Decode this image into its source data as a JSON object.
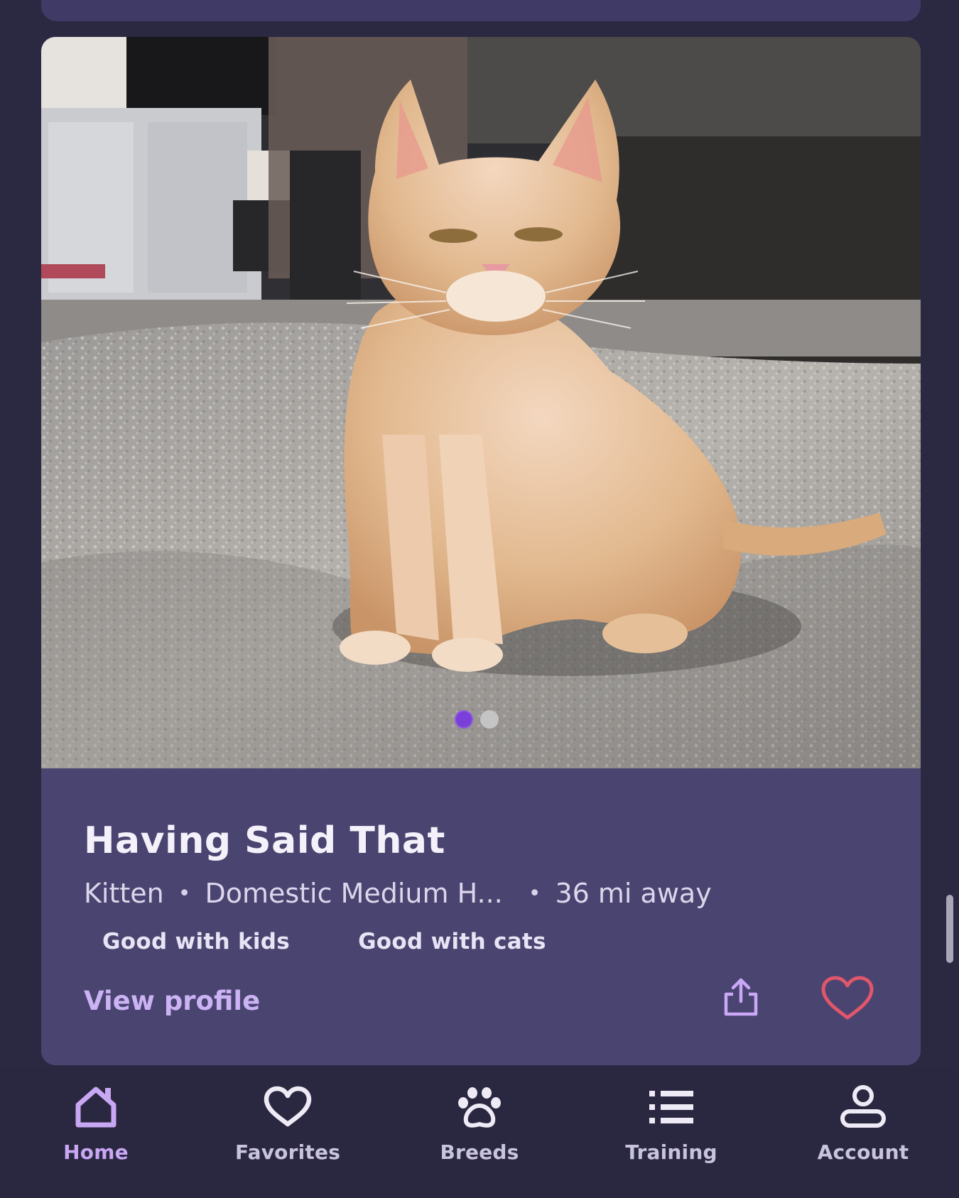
{
  "pet": {
    "name": "Having Said That",
    "age": "Kitten",
    "breed": "Domestic Medium H...",
    "distance": "36 mi away",
    "meta_separator": "•",
    "tags": [
      "Good with kids",
      "Good with cats"
    ],
    "view_profile_label": "View profile",
    "photo_count": 2,
    "active_photo_index": 0
  },
  "actions": {
    "share_icon": "share-icon",
    "favorite_icon": "heart-icon",
    "favorite_color": "#e0566b"
  },
  "bottom_nav": {
    "items": [
      {
        "label": "Home",
        "icon": "home-icon",
        "active": true
      },
      {
        "label": "Favorites",
        "icon": "heart-icon",
        "active": false
      },
      {
        "label": "Breeds",
        "icon": "paw-icon",
        "active": false
      },
      {
        "label": "Training",
        "icon": "list-icon",
        "active": false
      },
      {
        "label": "Account",
        "icon": "account-icon",
        "active": false
      }
    ]
  },
  "colors": {
    "background": "#2b2842",
    "card": "#4a4470",
    "accent": "#c8a7f3",
    "pager_active": "#7a3fd9",
    "pager_inactive": "#c4c4c4"
  }
}
